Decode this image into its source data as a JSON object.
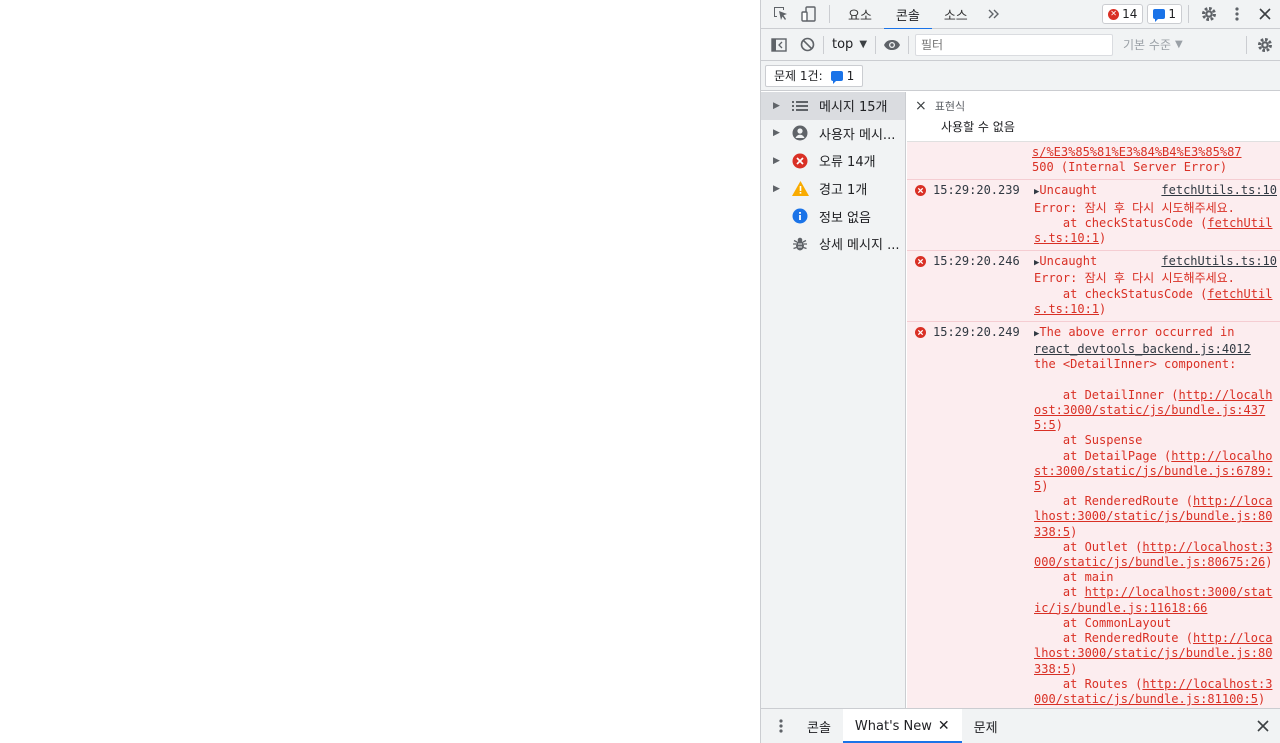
{
  "tabs": [
    {
      "label": "요소"
    },
    {
      "label": "콘솔"
    },
    {
      "label": "소스"
    }
  ],
  "badges": {
    "errors": "14",
    "messages": "1"
  },
  "toolbar": {
    "context": "top",
    "filter_placeholder": "필터",
    "level": "기본 수준"
  },
  "issues": {
    "label": "문제 1건:",
    "count": "1"
  },
  "sidebar": {
    "items": [
      {
        "label": "메시지 15개"
      },
      {
        "label": "사용자 메시..."
      },
      {
        "label": "오류 14개"
      },
      {
        "label": "경고 1개"
      },
      {
        "label": "정보 없음"
      },
      {
        "label": "상세 메시지 ..."
      }
    ]
  },
  "expression": {
    "title": "표현식",
    "value": "사용할 수 없음"
  },
  "console": {
    "partial": {
      "line1": "s/%E3%85%81%E3%84%B4%E3%85%87",
      "line2": "500 (Internal Server Error)"
    },
    "entries": [
      {
        "time": "15:29:20.239",
        "source": "fetchUtils.ts:10",
        "head": "Uncaught",
        "line1": "Error: 잠시 후 다시 시도해주세요.",
        "line2": "    at checkStatusCode (",
        "link": "fetchUtils.ts:10:1",
        "tail": ")"
      },
      {
        "time": "15:29:20.246",
        "source": "fetchUtils.ts:10",
        "head": "Uncaught",
        "line1": "Error: 잠시 후 다시 시도해주세요.",
        "line2": "    at checkStatusCode (",
        "link": "fetchUtils.ts:10:1",
        "tail": ")"
      }
    ],
    "big": {
      "time": "15:29:20.249",
      "head": "The above error occurred in",
      "source": "react_devtools_backend.js:4012",
      "component": "the <DetailInner> component:",
      "frames": [
        {
          "pre": "    at DetailInner (",
          "link": "http://localhost:3000/static/js/bundle.js:4375:5",
          "post": ")"
        },
        {
          "pre": "    at Suspense",
          "link": "",
          "post": ""
        },
        {
          "pre": "    at DetailPage (",
          "link": "http://localhost:3000/static/js/bundle.js:6789:5",
          "post": ")"
        },
        {
          "pre": "    at RenderedRoute (",
          "link": "http://localhost:3000/static/js/bundle.js:80338:5",
          "post": ")"
        },
        {
          "pre": "    at Outlet (",
          "link": "http://localhost:3000/static/js/bundle.js:80675:26",
          "post": ")"
        },
        {
          "pre": "    at main",
          "link": "",
          "post": ""
        },
        {
          "pre": "    at ",
          "link": "http://localhost:3000/static/js/bundle.js:11618:66",
          "post": ""
        },
        {
          "pre": "    at CommonLayout",
          "link": "",
          "post": ""
        },
        {
          "pre": "    at RenderedRoute (",
          "link": "http://localhost:3000/static/js/bundle.js:80338:5",
          "post": ")"
        },
        {
          "pre": "    at Routes (",
          "link": "http://localhost:3000/static/js/bundle.js:81100:5",
          "post": ")"
        }
      ]
    }
  },
  "drawer": {
    "tabs": [
      {
        "label": "콘솔"
      },
      {
        "label": "What's New"
      },
      {
        "label": "문제"
      }
    ]
  },
  "colors": {
    "accent": "#1a73e8",
    "error": "#d93025",
    "warning": "#f9ab00"
  }
}
